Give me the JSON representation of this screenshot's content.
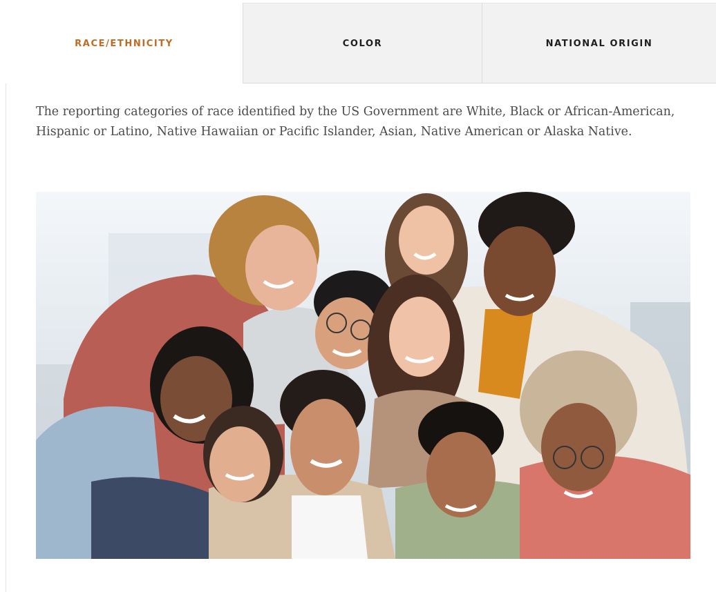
{
  "tabs": [
    {
      "label": "RACE/ETHNICITY",
      "active": true
    },
    {
      "label": "COLOR",
      "active": false
    },
    {
      "label": "NATIONAL ORIGIN",
      "active": false
    }
  ],
  "content": {
    "description": "The reporting categories of race identified by the US Government are White, Black or African-American, Hispanic or Latino, Native Hawaiian or Pacific Islander, Asian, Native American or Alaska Native."
  },
  "colors": {
    "active_tab_text": "#c06a22",
    "inactive_tab_bg": "#f2f2f2",
    "tab_text": "#1e1e1e",
    "body_text": "#4a4a4a"
  }
}
